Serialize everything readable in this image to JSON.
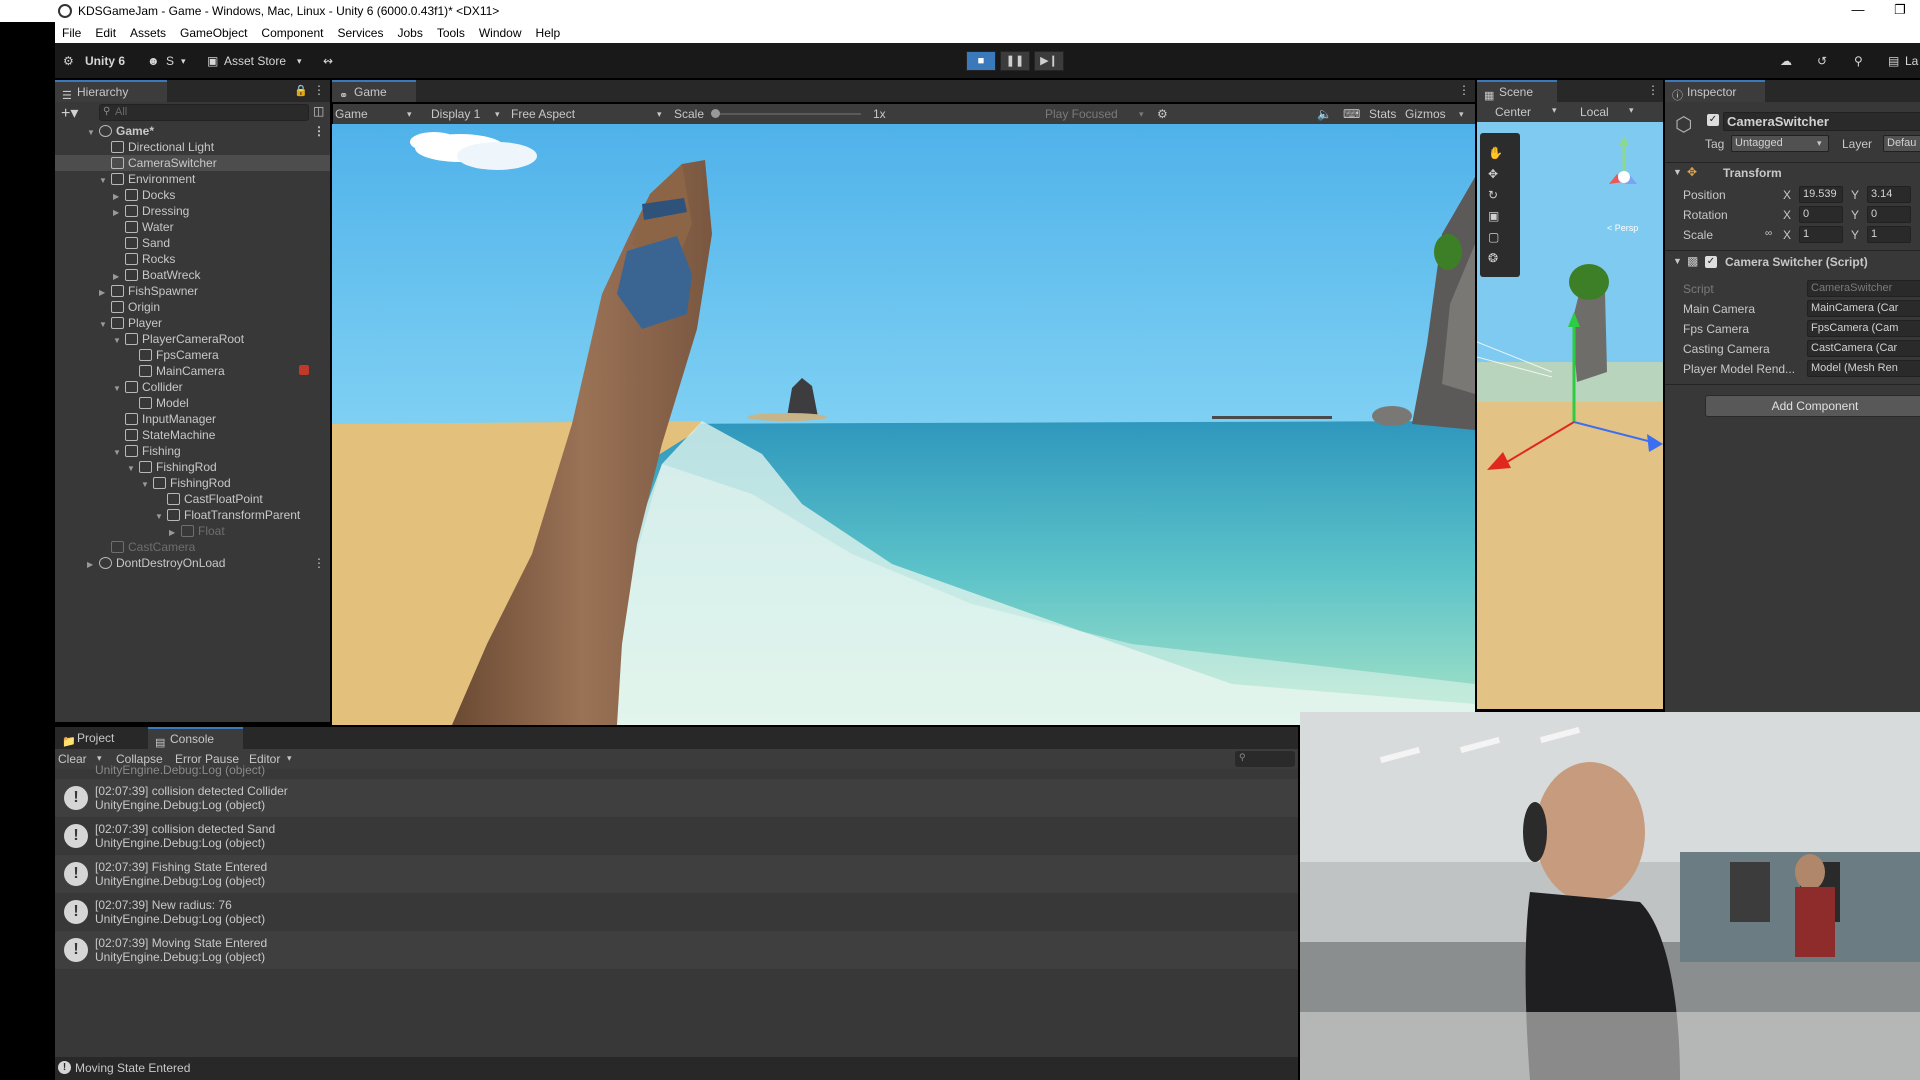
{
  "window": {
    "title": "KDSGameJam - Game - Windows, Mac, Linux - Unity 6 (6000.0.43f1)* <DX11>",
    "menu": [
      "File",
      "Edit",
      "Assets",
      "GameObject",
      "Component",
      "Services",
      "Jobs",
      "Tools",
      "Window",
      "Help"
    ]
  },
  "toolbar": {
    "unity_label": "Unity 6",
    "account_label": "S",
    "asset_store_label": "Asset Store",
    "right_cutoff": "La"
  },
  "hierarchy": {
    "tab_label": "Hierarchy",
    "search_placeholder": "All",
    "items": [
      {
        "label": "Game*"
      },
      {
        "label": "Directional Light"
      },
      {
        "label": "CameraSwitcher"
      },
      {
        "label": "Environment"
      },
      {
        "label": "Docks"
      },
      {
        "label": "Dressing"
      },
      {
        "label": "Water"
      },
      {
        "label": "Sand"
      },
      {
        "label": "Rocks"
      },
      {
        "label": "BoatWreck"
      },
      {
        "label": "FishSpawner"
      },
      {
        "label": "Origin"
      },
      {
        "label": "Player"
      },
      {
        "label": "PlayerCameraRoot"
      },
      {
        "label": "FpsCamera"
      },
      {
        "label": "MainCamera"
      },
      {
        "label": "Collider"
      },
      {
        "label": "Model"
      },
      {
        "label": "InputManager"
      },
      {
        "label": "StateMachine"
      },
      {
        "label": "Fishing"
      },
      {
        "label": "FishingRod"
      },
      {
        "label": "FishingRod"
      },
      {
        "label": "CastFloatPoint"
      },
      {
        "label": "FloatTransformParent"
      },
      {
        "label": "Float"
      },
      {
        "label": "CastCamera"
      },
      {
        "label": "DontDestroyOnLoad"
      }
    ]
  },
  "game": {
    "tab_label": "Game",
    "display_mode": "Game",
    "display": "Display 1",
    "aspect": "Free Aspect",
    "scale_label": "Scale",
    "scale_value": "1x",
    "play_focused": "Play Focused",
    "stats": "Stats",
    "gizmos": "Gizmos"
  },
  "scene": {
    "tab_label": "Scene",
    "pivot_mode": "Center",
    "pivot_space": "Local",
    "persp_label": "< Persp"
  },
  "inspector": {
    "tab_label": "Inspector",
    "object_name": "CameraSwitcher",
    "tag_label": "Tag",
    "tag_value": "Untagged",
    "layer_label": "Layer",
    "layer_value": "Defau",
    "transform_title": "Transform",
    "position_label": "Position",
    "position": {
      "x": "19.539",
      "y": "3.14"
    },
    "rotation_label": "Rotation",
    "rotation": {
      "x": "0",
      "y": "0"
    },
    "scale_label": "Scale",
    "scale": {
      "x": "1",
      "y": "1"
    },
    "script_component_title": "Camera Switcher (Script)",
    "fields": [
      {
        "label": "Script",
        "value": "CameraSwitcher"
      },
      {
        "label": "Main Camera",
        "value": "MainCamera (Car"
      },
      {
        "label": "Fps Camera",
        "value": "FpsCamera (Cam"
      },
      {
        "label": "Casting Camera",
        "value": "CastCamera (Car"
      },
      {
        "label": "Player Model Rend...",
        "value": "Model (Mesh Ren"
      }
    ],
    "add_component": "Add Component"
  },
  "bottom": {
    "project_tab": "Project",
    "console_tab": "Console",
    "clear": "Clear",
    "collapse": "Collapse",
    "error_pause": "Error Pause",
    "editor": "Editor",
    "partial_row": "UnityEngine.Debug:Log (object)",
    "logs": [
      {
        "line1": "[02:07:39] collision detected   Collider",
        "line2": "UnityEngine.Debug:Log (object)"
      },
      {
        "line1": "[02:07:39] collision detected   Sand",
        "line2": "UnityEngine.Debug:Log (object)"
      },
      {
        "line1": "[02:07:39] Fishing State Entered",
        "line2": "UnityEngine.Debug:Log (object)"
      },
      {
        "line1": "[02:07:39] New radius: 76",
        "line2": "UnityEngine.Debug:Log (object)"
      },
      {
        "line1": "[02:07:39] Moving State Entered",
        "line2": "UnityEngine.Debug:Log (object)"
      }
    ],
    "status": "Moving State Entered"
  },
  "colors": {
    "accent": "#3a79bb",
    "sky": "#5ab8ec",
    "sea": "#46b0c8",
    "sand": "#e3c07b"
  }
}
